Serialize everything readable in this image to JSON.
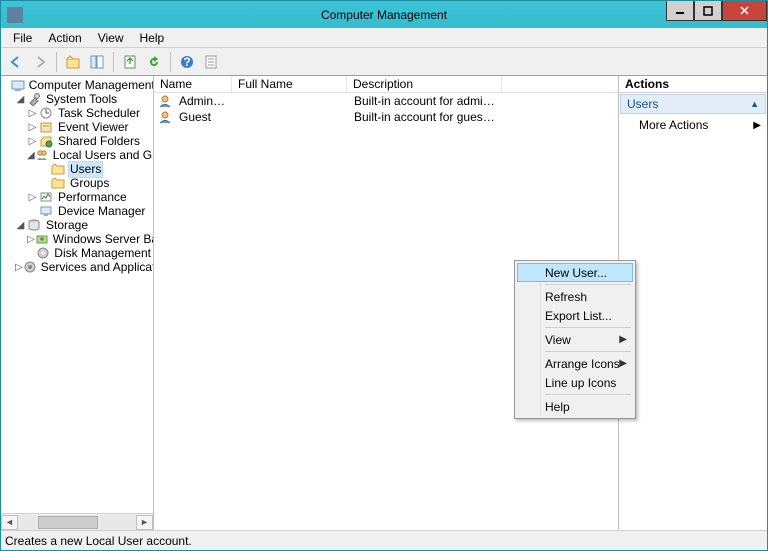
{
  "window": {
    "title": "Computer Management"
  },
  "menu": {
    "file": "File",
    "action": "Action",
    "view": "View",
    "help": "Help"
  },
  "tree": {
    "root": "Computer Management (Local",
    "system_tools": "System Tools",
    "task_scheduler": "Task Scheduler",
    "event_viewer": "Event Viewer",
    "shared_folders": "Shared Folders",
    "local_users_groups": "Local Users and Groups",
    "users": "Users",
    "groups": "Groups",
    "performance": "Performance",
    "device_manager": "Device Manager",
    "storage": "Storage",
    "wsb": "Windows Server Backup",
    "disk_mgmt": "Disk Management",
    "services_apps": "Services and Applications"
  },
  "list": {
    "columns": {
      "name": "Name",
      "full_name": "Full Name",
      "description": "Description"
    },
    "col_widths": {
      "name": 78,
      "full_name": 115,
      "description": 155
    },
    "rows": [
      {
        "name": "Administrator",
        "full_name": "",
        "description": "Built-in account for administering..."
      },
      {
        "name": "Guest",
        "full_name": "",
        "description": "Built-in account for guest access t..."
      }
    ]
  },
  "actions": {
    "header": "Actions",
    "category": "Users",
    "more": "More Actions"
  },
  "ctx": {
    "new_user": "New User...",
    "refresh": "Refresh",
    "export_list": "Export List...",
    "view": "View",
    "arrange_icons": "Arrange Icons",
    "line_up": "Line up Icons",
    "help": "Help"
  },
  "status": "Creates a new Local User account."
}
